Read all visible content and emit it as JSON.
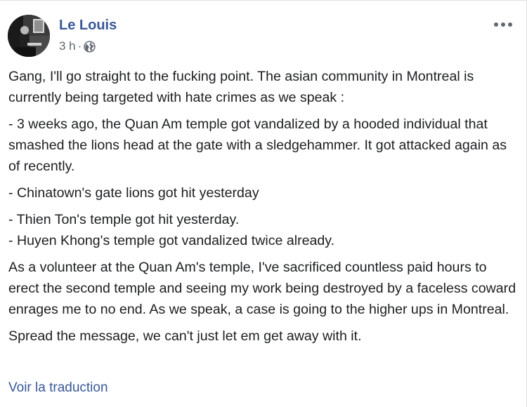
{
  "post": {
    "author": "Le Louis",
    "time": "3 h",
    "separator": "·",
    "privacy_icon": "globe-icon",
    "more_icon": "more-options-icon",
    "paragraphs": [
      "Gang, I'll go straight to the fucking point. The asian community in Montreal is currently being targeted with hate crimes as we speak :",
      "- 3 weeks ago, the Quan Am temple got vandalized by a hooded individual that smashed the lions head at the gate with a sledgehammer. It got attacked again as of recently.",
      "- Chinatown's gate lions got hit yesterday",
      "- Thien Ton's temple got hit yesterday.",
      "- Huyen Khong's temple got vandalized twice already.",
      "As a volunteer at the Quan Am's temple, I've sacrificed countless paid hours to erect the second temple and seeing my work being destroyed by a faceless coward enrages me to no end. As we speak, a case is going to the higher ups in Montreal.",
      "Spread the message, we can't just let em get away with it."
    ],
    "translate_link": "Voir la traduction"
  },
  "colors": {
    "author_link": "#385898",
    "meta_text": "#616770",
    "body_text": "#1c1e21"
  }
}
